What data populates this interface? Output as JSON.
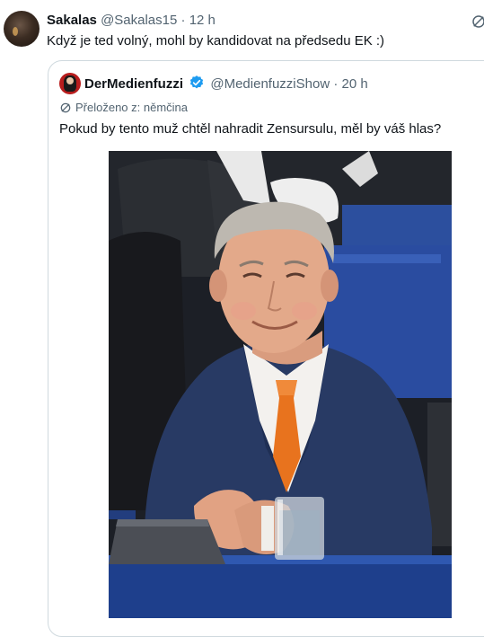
{
  "tweet": {
    "display_name": "Sakalas",
    "handle": "@Sakalas15",
    "separator": "·",
    "time": "12 h",
    "text": "Když je ted volný, mohl by kandidovat na předsedu EK :)"
  },
  "quote": {
    "display_name": "DerMedienfuzzi",
    "handle": "@MedienfuzziShow",
    "separator": "·",
    "time": "20 h",
    "translated_label": "Přeloženo z: němčina",
    "text": "Pokud by tento muž chtěl nahradit Zensursulu, měl by váš hlas?",
    "image": {
      "icon": "photo",
      "description_colors": {
        "suit": "#283a64",
        "tie": "#e8731e",
        "seats": "#2a4ea0",
        "desk": "#1e3f8c"
      }
    }
  },
  "colors": {
    "verified": "#1d9bf0",
    "muted_text": "#536471",
    "border": "#cfd9de"
  },
  "icons": {
    "translate": "translate-icon",
    "verified": "verified-badge-icon"
  }
}
